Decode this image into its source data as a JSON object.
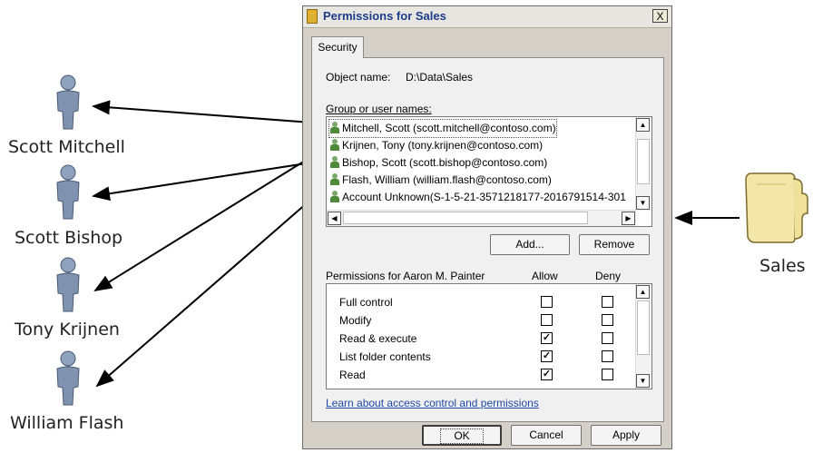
{
  "people": [
    {
      "name": "Scott Mitchell"
    },
    {
      "name": "Scott Bishop"
    },
    {
      "name": "Tony Krijnen"
    },
    {
      "name": "William Flash"
    }
  ],
  "folder": {
    "label": "Sales"
  },
  "dialog": {
    "title": "Permissions for Sales",
    "close_glyph": "X",
    "tab": "Security",
    "object_name_label": "Object name:",
    "object_name_value": "D:\\Data\\Sales",
    "group_label": "Group or user names:",
    "users": [
      "Mitchell, Scott (scott.mitchell@contoso.com)",
      "Krijnen, Tony (tony.krijnen@contoso.com)",
      "Bishop, Scott (scott.bishop@contoso.com)",
      "Flash, William (william.flash@contoso.com)",
      "Account Unknown(S-1-5-21-3571218177-2016791514-301"
    ],
    "add_button": "Add...",
    "remove_button": "Remove",
    "permissions_label": "Permissions for Aaron M. Painter",
    "allow_header": "Allow",
    "deny_header": "Deny",
    "permissions": [
      {
        "name": "Full control",
        "allow": false,
        "deny": false
      },
      {
        "name": "Modify",
        "allow": false,
        "deny": false
      },
      {
        "name": "Read & execute",
        "allow": true,
        "deny": false
      },
      {
        "name": "List folder contents",
        "allow": true,
        "deny": false
      },
      {
        "name": "Read",
        "allow": true,
        "deny": false
      }
    ],
    "learn_link": "Learn about access control and permissions",
    "ok_button": "OK",
    "cancel_button": "Cancel",
    "apply_button": "Apply"
  },
  "colors": {
    "person": "#7f93b0",
    "folder": "#f2e7a8",
    "title_text": "#1b3b8c"
  }
}
